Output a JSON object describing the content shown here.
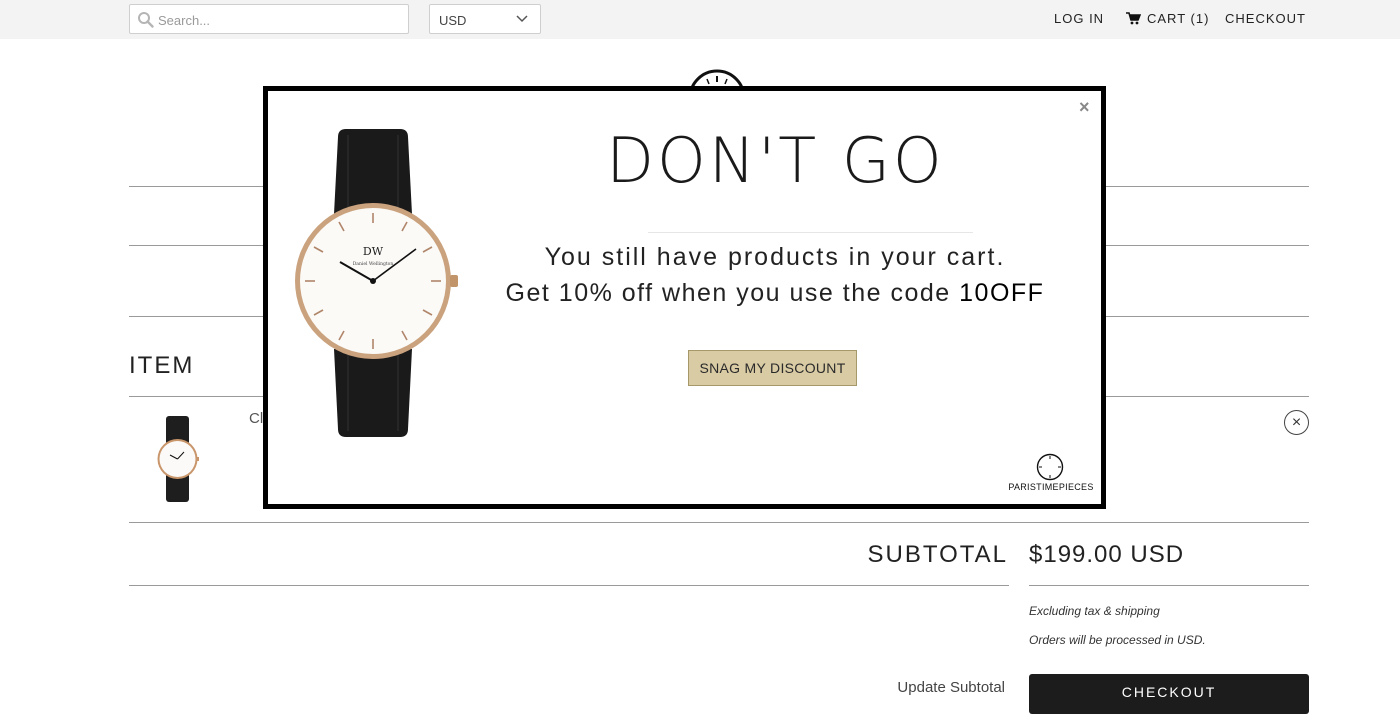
{
  "header": {
    "search_placeholder": "Search...",
    "currency": "USD",
    "login": "LOG IN",
    "cart": "CART (1)",
    "checkout": "CHECKOUT"
  },
  "cart": {
    "item_heading": "ITEM",
    "product_name_partial": "Cl",
    "remove_symbol": "×",
    "subtotal_label": "SUBTOTAL",
    "subtotal_value": "$199.00 USD",
    "note_tax": "Excluding tax & shipping",
    "note_currency": "Orders will be processed in USD.",
    "update_subtotal": "Update Subtotal",
    "checkout_button": "CHECKOUT"
  },
  "popup": {
    "close": "×",
    "title": "DON'T GO",
    "line1": "You still have products in your cart.",
    "line2_prefix": "Get 10% off when you use the code ",
    "code": "10OFF",
    "button": "SNAG MY DISCOUNT",
    "brand_name": "PARISTIMEPIECES"
  },
  "colors": {
    "topbar_bg": "#f3f3f3",
    "button_gold": "#d9cba4",
    "checkout_dark": "#1c1c1c"
  }
}
